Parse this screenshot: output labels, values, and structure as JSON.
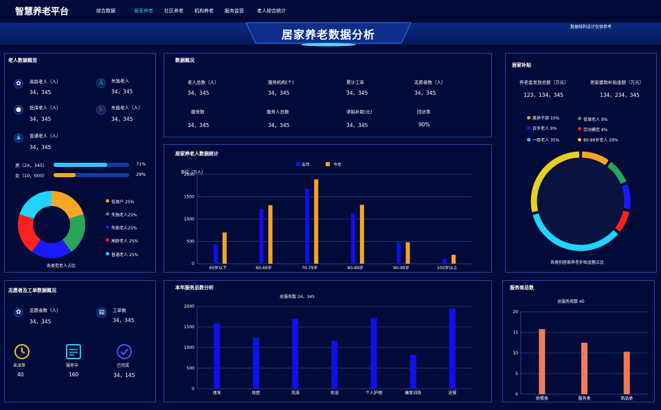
{
  "header": {
    "logo": "智慧养老平台",
    "nav": [
      "综合数据",
      "居家养老",
      "社区养老",
      "机构养老",
      "服务监管",
      "老人综合统计"
    ],
    "title": "居家养老数据分析",
    "note": "数据结构设计仅供参考"
  },
  "elder": {
    "title": "老人数据概览",
    "items": [
      {
        "label": "高龄老人（人）",
        "value": "34，345",
        "icon": "elder-icon"
      },
      {
        "label": "失独老人",
        "value": "34，345",
        "icon": "walking-person-icon"
      },
      {
        "label": "低保老人（人）",
        "value": "34，345",
        "icon": "person-icon"
      },
      {
        "label": "失能老人（人）",
        "value": "34，345",
        "icon": "wheelchair-icon"
      },
      {
        "label": "普通老人（人）",
        "value": "34，345",
        "icon": "standing-person-icon"
      }
    ],
    "gender": [
      {
        "label": "男（24，345）",
        "pct": "71%",
        "fraction": 0.71,
        "color": "#2ec5ff"
      },
      {
        "label": "女（10，000）",
        "pct": "29%",
        "fraction": 0.29,
        "color": "#f5a623"
      }
    ],
    "donut_caption": "各类型老人占比",
    "legend": [
      {
        "label": "低保户 25%",
        "color": "#f5a623"
      },
      {
        "label": "失独老人25%",
        "color": "#27a55a"
      },
      {
        "label": "失能老人25%",
        "color": "#1a1aff"
      },
      {
        "label": "高龄老人  25%",
        "color": "#ff2020"
      },
      {
        "label": "普通老人 25%",
        "color": "#21d4ff"
      }
    ],
    "slices": [
      20,
      20,
      20,
      20,
      20
    ]
  },
  "overview": {
    "title": "数据概况",
    "items": [
      {
        "label": "老人总数（人）",
        "value": "34，345"
      },
      {
        "label": "服务机构(个)",
        "value": "34，345"
      },
      {
        "label": "累计工单",
        "value": "34，345"
      },
      {
        "label": "志愿者数（人）",
        "value": "34，345"
      },
      {
        "label": "服务数",
        "value": "34，345"
      },
      {
        "label": "服务人员数",
        "value": "34，345"
      },
      {
        "label": "津贴补助(元)",
        "value": "34，345"
      },
      {
        "label": "回访率",
        "value": "90%"
      }
    ]
  },
  "subsidy": {
    "title": "居家补贴",
    "items": [
      {
        "label": "养老金发放总额（万元）",
        "value": "123，134，345"
      },
      {
        "label": "居家援助补贴金额（万元）",
        "value": "134，234，345"
      }
    ],
    "legend": [
      {
        "label": "离休干部  10%",
        "color": "#f5a623"
      },
      {
        "label": "低保老人    9%",
        "color": "#27a55a"
      },
      {
        "label": "百岁老人   9%",
        "color": "#1a1aff"
      },
      {
        "label": "劳动模范    8%",
        "color": "#ff2020"
      },
      {
        "label": "一般老人    35%",
        "color": "#21d4ff"
      },
      {
        "label": "80-99岁老人 29%",
        "color": "#e8d020"
      }
    ],
    "caption": "各类别居家养老补贴金额占比",
    "slices": [
      {
        "v": 10,
        "color": "#f5a623"
      },
      {
        "v": 9,
        "color": "#27a55a"
      },
      {
        "v": 9,
        "color": "#1a1aff"
      },
      {
        "v": 8,
        "color": "#ff2020"
      },
      {
        "v": 35,
        "color": "#21d4ff"
      },
      {
        "v": 29,
        "color": "#e8d020"
      }
    ]
  },
  "volunteer": {
    "title": "志愿者及工单数据概况",
    "items": [
      {
        "label": "志愿者数（人）",
        "value": "34，345"
      },
      {
        "label": "工单数",
        "value": "34，345"
      }
    ],
    "status": [
      {
        "label": "未派单",
        "value": "40"
      },
      {
        "label": "服务中",
        "value": "160"
      },
      {
        "label": "已完成",
        "value": "34，145"
      }
    ]
  },
  "chart_data": [
    {
      "type": "bar",
      "title": "居家养老人数据统计",
      "ylabel": "单位（万人）",
      "ylim": [
        0,
        2000
      ],
      "yticks": [
        "0",
        "500",
        "1000",
        "1500",
        "2000"
      ],
      "categories": [
        "60岁以下",
        "60-69岁",
        "70-79岁",
        "80-89岁",
        "90-99岁",
        "100岁以上"
      ],
      "series": [
        {
          "name": "去年",
          "color": "#1010e8",
          "values": [
            430,
            1220,
            1680,
            1120,
            480,
            110
          ]
        },
        {
          "name": "今年",
          "color": "#f5a623",
          "values": [
            700,
            1310,
            1890,
            1320,
            480,
            200
          ]
        }
      ]
    },
    {
      "type": "bar",
      "title": "本年服务总数分析",
      "summary": "总服务数  34，345",
      "ylim": [
        0,
        2000
      ],
      "yticks": [
        "0",
        "500",
        "1000",
        "1500",
        "2000"
      ],
      "categories": [
        "理发",
        "助医",
        "洗澡",
        "助浴",
        "个人护理",
        "康复训练",
        "送餐"
      ],
      "series": [
        {
          "color": "#1010e8",
          "values": [
            1590,
            1230,
            1700,
            1160,
            1720,
            820,
            1950
          ]
        }
      ]
    },
    {
      "type": "bar",
      "title": "服务商总数",
      "summary": "总服务商数    40",
      "ylim": [
        0,
        20
      ],
      "yticks": [
        "0",
        "5",
        "10",
        "15",
        "20"
      ],
      "categories": [
        "助餐类",
        "服务类",
        "商品类"
      ],
      "series": [
        {
          "color": "#f07a5c",
          "values": [
            15.8,
            12.5,
            10.3
          ]
        }
      ]
    }
  ]
}
